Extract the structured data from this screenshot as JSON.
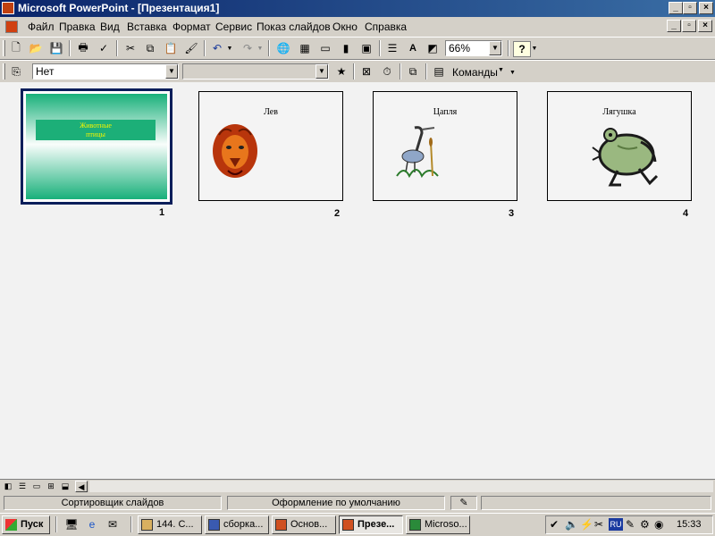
{
  "window": {
    "title": "Microsoft PowerPoint - [Презентация1]"
  },
  "menu": [
    "Файл",
    "Правка",
    "Вид",
    "Вставка",
    "Формат",
    "Сервис",
    "Показ слайдов",
    "Окно",
    "Справка"
  ],
  "toolbar": {
    "zoom": "66%"
  },
  "toolbar2": {
    "animation_value": "Нет",
    "effect_value": "",
    "commands_label": "Команды"
  },
  "slides": [
    {
      "number": "1",
      "title": "Животные\nптицы",
      "selected": true
    },
    {
      "number": "2",
      "title": "Лев"
    },
    {
      "number": "3",
      "title": "Цапля"
    },
    {
      "number": "4",
      "title": "Лягушка"
    }
  ],
  "status": {
    "view": "Сортировщик слайдов",
    "design": "Оформление по умолчанию"
  },
  "taskbar": {
    "start": "Пуск",
    "tasks": [
      "144. С...",
      "сборка...",
      "Основ...",
      "Презе...",
      "Microso..."
    ],
    "clock": "15:33",
    "lang": "RU"
  }
}
